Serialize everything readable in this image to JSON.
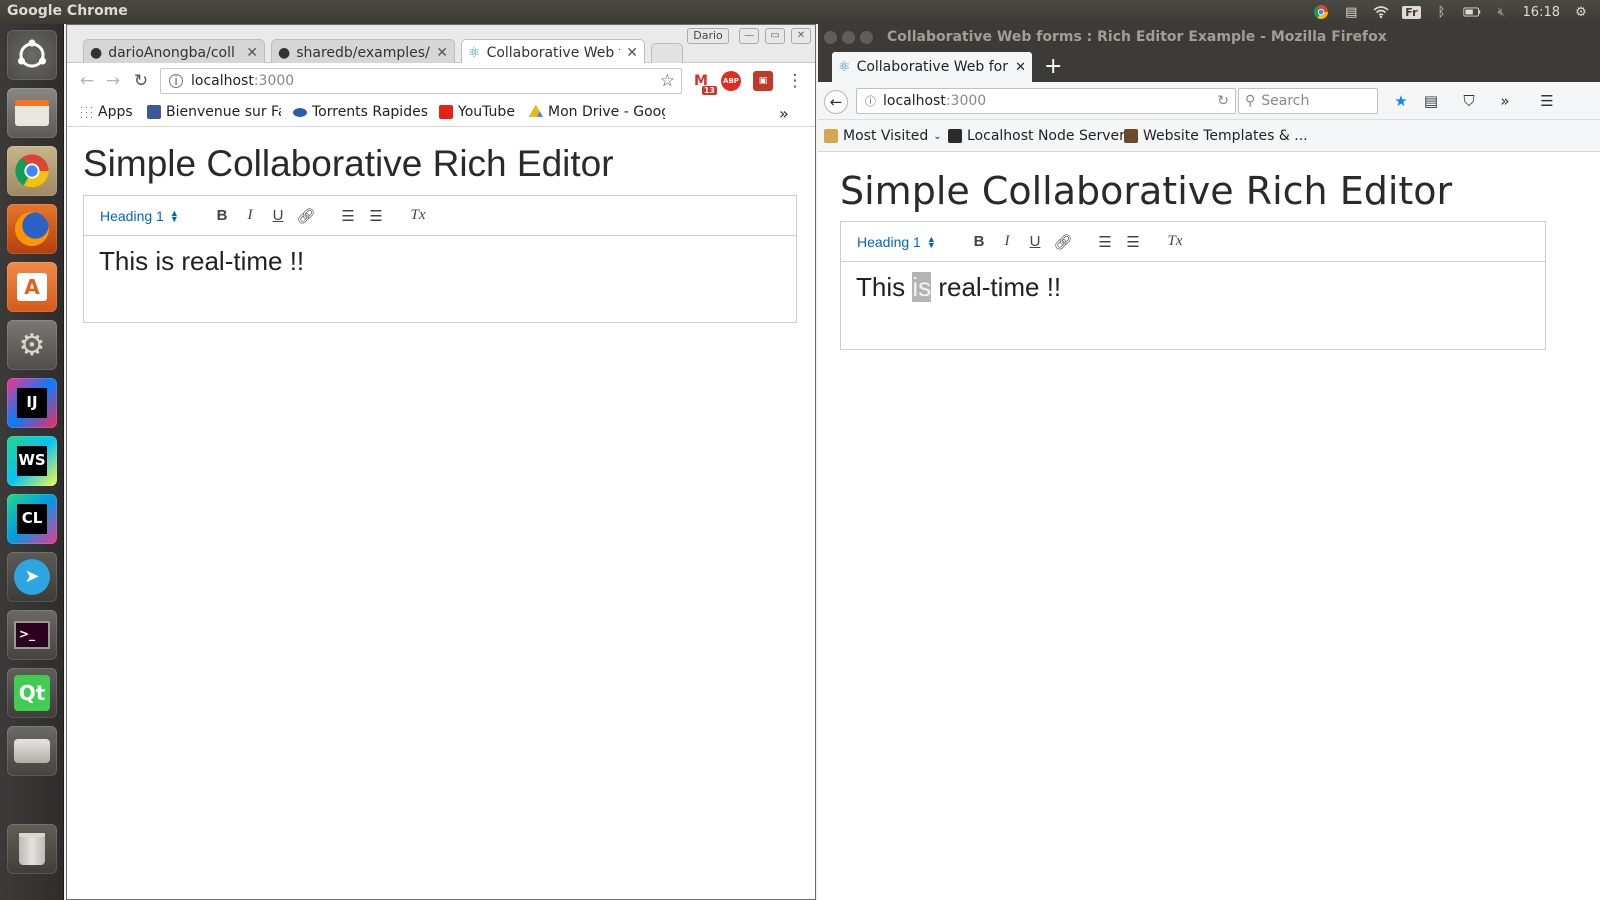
{
  "top_panel": {
    "title": "Google Chrome",
    "keyboard": "Fr",
    "clock": "16:18"
  },
  "launcher": {
    "items": [
      "ubuntu-dash",
      "files",
      "chrome",
      "firefox",
      "software-center",
      "system-settings",
      "intellij",
      "webstorm",
      "clion",
      "telegram",
      "terminal",
      "qt-creator",
      "disk",
      "trash"
    ],
    "labels": {
      "intellij": "IJ",
      "webstorm": "WS",
      "clion": "CL",
      "terminal": ">_",
      "qt": "Qt"
    }
  },
  "chrome": {
    "tabs": [
      {
        "label": "darioAnongba/coll"
      },
      {
        "label": "sharedb/examples/"
      },
      {
        "label": "Collaborative Web f"
      }
    ],
    "close_glyph": "✕",
    "profile": "Dario",
    "url_host": "localhost",
    "url_port": ":3000",
    "gmail_count": "13",
    "bookmarks": [
      "Apps",
      "Bienvenue sur Fa",
      "Torrents Rapides",
      "YouTube",
      "Mon Drive - Goog"
    ],
    "overflow": "»"
  },
  "page": {
    "title": "Simple Collaborative Rich Editor",
    "heading_select": "Heading 1",
    "toolbar": {
      "bold": "B",
      "italic": "I",
      "underline": "U",
      "clear": "Tx"
    },
    "content_before": "This ",
    "content_highlight": "is",
    "content_after": " real-time !!",
    "content_full": "This is real-time !!"
  },
  "firefox": {
    "window_title": "Collaborative Web forms : Rich Editor Example - Mozilla Firefox",
    "tab_label": "Collaborative Web forr",
    "new_tab": "+",
    "url_host": "localhost",
    "url_port": ":3000",
    "search_placeholder": "Search",
    "overflow": "»",
    "bookmarks": [
      "Most Visited",
      "Localhost Node Server",
      "Website Templates & ..."
    ]
  },
  "colors": {
    "link_blue": "#06c",
    "panel_bg": "#3c3b37",
    "highlight": "#b4b4b4"
  }
}
